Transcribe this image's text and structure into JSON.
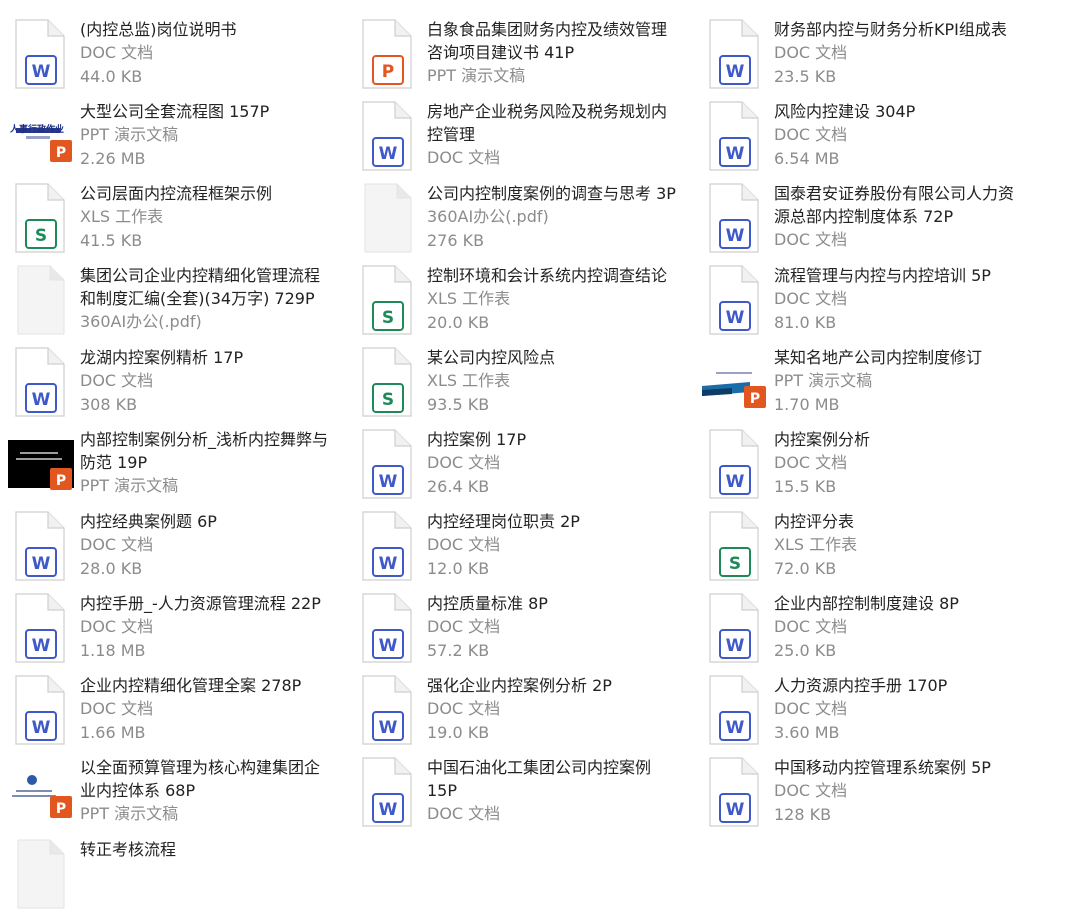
{
  "colors": {
    "doc": "#3f59c9",
    "xls": "#1e8a5a",
    "ppt": "#e2561f",
    "title": "#222222",
    "meta": "#8c8c8c"
  },
  "files": [
    {
      "title": "(内控总监)岗位说明书",
      "type": "DOC 文档",
      "size": "44.0 KB",
      "icon": "word-icon"
    },
    {
      "title": "白象食品集团财务内控及绩效管理\n咨询项目建议书 41P",
      "type": "PPT 演示文稿",
      "size": "",
      "icon": "powerpoint-icon"
    },
    {
      "title": "财务部内控与财务分析KPI组成表",
      "type": "DOC 文档",
      "size": "23.5 KB",
      "icon": "word-icon"
    },
    {
      "title": "大型公司全套流程图 157P",
      "type": "PPT 演示文稿",
      "size": "2.26 MB",
      "icon": "ppt-thumbnail-icon",
      "thumb_text": "人事行政作业"
    },
    {
      "title": "房地产企业税务风险及税务规划内\n控管理",
      "type": "DOC 文档",
      "size": "",
      "icon": "word-icon"
    },
    {
      "title": "风险内控建设 304P",
      "type": "DOC 文档",
      "size": "6.54 MB",
      "icon": "word-icon"
    },
    {
      "title": "公司层面内控流程框架示例",
      "type": "XLS 工作表",
      "size": "41.5 KB",
      "icon": "excel-icon"
    },
    {
      "title": "公司内控制度案例的调查与思考 3P",
      "type": "360AI办公(.pdf)",
      "size": "276 KB",
      "icon": "blank-file-icon"
    },
    {
      "title": "国泰君安证券股份有限公司人力资\n源总部内控制度体系 72P",
      "type": "DOC 文档",
      "size": "",
      "icon": "word-icon"
    },
    {
      "title": "集团公司企业内控精细化管理流程\n和制度汇编(全套)(34万字) 729P",
      "type": "360AI办公(.pdf)",
      "size": "",
      "icon": "blank-file-icon"
    },
    {
      "title": "控制环境和会计系统内控调查结论",
      "type": "XLS 工作表",
      "size": "20.0 KB",
      "icon": "excel-icon"
    },
    {
      "title": "流程管理与内控与内控培训 5P",
      "type": "DOC 文档",
      "size": "81.0 KB",
      "icon": "word-icon"
    },
    {
      "title": "龙湖内控案例精析 17P",
      "type": "DOC 文档",
      "size": "308 KB",
      "icon": "word-icon"
    },
    {
      "title": "某公司内控风险点",
      "type": "XLS 工作表",
      "size": "93.5 KB",
      "icon": "excel-icon"
    },
    {
      "title": "某知名地产公司内控制度修订",
      "type": "PPT 演示文稿",
      "size": "1.70 MB",
      "icon": "ppt-thumbnail-icon",
      "thumb_text": ""
    },
    {
      "title": "内部控制案例分析_浅析内控舞弊与\n防范 19P",
      "type": "PPT 演示文稿",
      "size": "",
      "icon": "ppt-thumbnail-icon",
      "thumb_text": ""
    },
    {
      "title": "内控案例 17P",
      "type": "DOC 文档",
      "size": "26.4 KB",
      "icon": "word-icon"
    },
    {
      "title": "内控案例分析",
      "type": "DOC 文档",
      "size": "15.5 KB",
      "icon": "word-icon"
    },
    {
      "title": "内控经典案例题 6P",
      "type": "DOC 文档",
      "size": "28.0 KB",
      "icon": "word-icon"
    },
    {
      "title": "内控经理岗位职责 2P",
      "type": "DOC 文档",
      "size": "12.0 KB",
      "icon": "word-icon"
    },
    {
      "title": "内控评分表",
      "type": "XLS 工作表",
      "size": "72.0 KB",
      "icon": "excel-icon"
    },
    {
      "title": "内控手册_-人力资源管理流程 22P",
      "type": "DOC 文档",
      "size": "1.18 MB",
      "icon": "word-icon"
    },
    {
      "title": "内控质量标准 8P",
      "type": "DOC 文档",
      "size": "57.2 KB",
      "icon": "word-icon"
    },
    {
      "title": "企业内部控制制度建设 8P",
      "type": "DOC 文档",
      "size": "25.0 KB",
      "icon": "word-icon"
    },
    {
      "title": "企业内控精细化管理全案 278P",
      "type": "DOC 文档",
      "size": "1.66 MB",
      "icon": "word-icon"
    },
    {
      "title": "强化企业内控案例分析 2P",
      "type": "DOC 文档",
      "size": "19.0 KB",
      "icon": "word-icon"
    },
    {
      "title": "人力资源内控手册 170P",
      "type": "DOC 文档",
      "size": "3.60 MB",
      "icon": "word-icon"
    },
    {
      "title": "以全面预算管理为核心构建集团企\n业内控体系 68P",
      "type": "PPT 演示文稿",
      "size": "",
      "icon": "ppt-thumbnail-icon",
      "thumb_text": ""
    },
    {
      "title": "中国石油化工集团公司内控案例\n15P",
      "type": "DOC 文档",
      "size": "",
      "icon": "word-icon"
    },
    {
      "title": "中国移动内控管理系统案例 5P",
      "type": "DOC 文档",
      "size": "128 KB",
      "icon": "word-icon"
    },
    {
      "title": "转正考核流程",
      "type": "",
      "size": "",
      "icon": "blank-file-icon"
    }
  ]
}
